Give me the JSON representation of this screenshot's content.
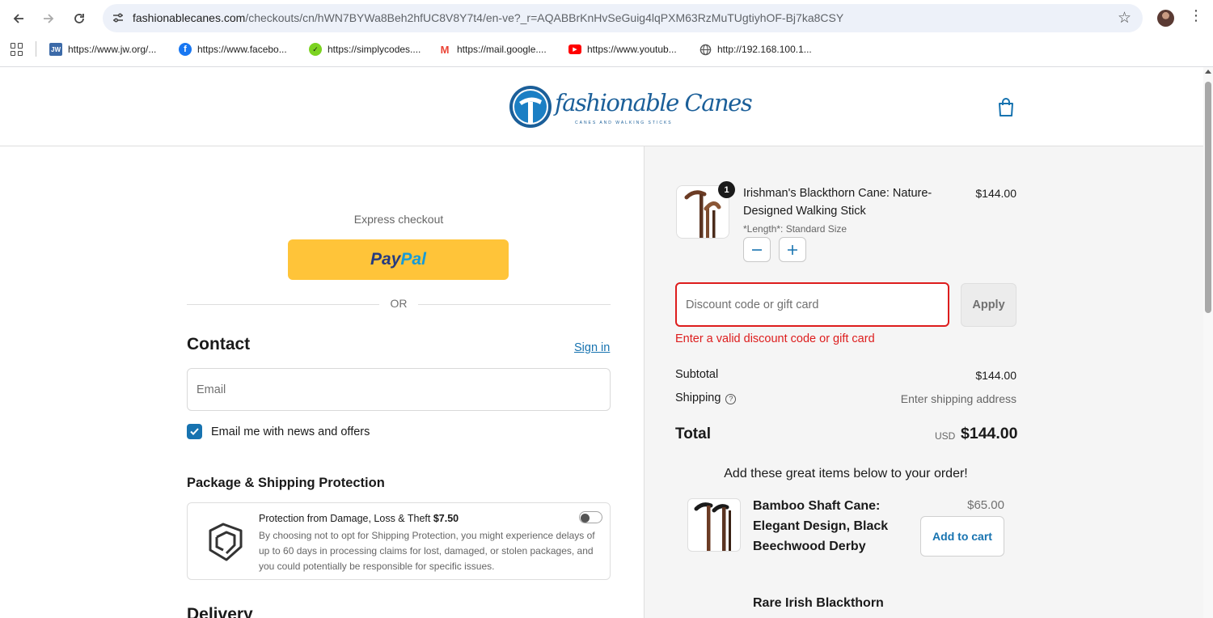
{
  "browser": {
    "url_host": "fashionablecanes.com",
    "url_path": "/checkouts/cn/hWN7BYWa8Beh2hfUC8V8Y7t4/en-ve?_r=AQABBrKnHvSeGuig4lqPXM63RzMuTUgtiyhOF-Bj7ka8CSY",
    "bookmarks": [
      {
        "label": "https://www.jw.org/...",
        "icon": "jw-icon"
      },
      {
        "label": "https://www.facebo...",
        "icon": "facebook-icon"
      },
      {
        "label": "https://simplycodes....",
        "icon": "simplycodes-icon"
      },
      {
        "label": "https://mail.google....",
        "icon": "gmail-icon"
      },
      {
        "label": "https://www.youtub...",
        "icon": "youtube-icon"
      },
      {
        "label": "http://192.168.100.1...",
        "icon": "globe-icon"
      }
    ]
  },
  "store": {
    "logo_text": "fashionable Canes",
    "logo_tagline": "CANES AND WALKING STICKS",
    "accent_color": "#1773b0"
  },
  "checkout": {
    "express_label": "Express checkout",
    "paypal_pay": "Pay",
    "paypal_pal": "Pal",
    "or_label": "OR",
    "contact_heading": "Contact",
    "signin_label": "Sign in",
    "email_placeholder": "Email",
    "newsletter_label": "Email me with news and offers",
    "newsletter_checked": true,
    "protection_heading": "Package & Shipping Protection",
    "protection_title": "Protection from Damage, Loss & Theft ",
    "protection_price": "$7.50",
    "protection_desc": "By choosing not to opt for Shipping Protection, you might experience delays of up to 60 days in processing claims for lost, damaged, or stolen packages, and you could potentially be responsible for specific issues.",
    "protection_enabled": false,
    "delivery_heading": "Delivery"
  },
  "summary": {
    "item": {
      "quantity": "1",
      "name": "Irishman's Blackthorn Cane: Nature-Designed Walking Stick",
      "variant": "*Length*: Standard Size",
      "price": "$144.00"
    },
    "discount_placeholder": "Discount code or gift card",
    "apply_label": "Apply",
    "discount_error": "Enter a valid discount code or gift card",
    "subtotal_label": "Subtotal",
    "subtotal_value": "$144.00",
    "shipping_label": "Shipping",
    "shipping_value": "Enter shipping address",
    "total_label": "Total",
    "total_currency": "USD",
    "total_value": "$144.00",
    "upsell_title": "Add these great items below to your order!",
    "upsells": [
      {
        "name": "Bamboo Shaft Cane: Elegant Design, Black Beechwood Derby",
        "price": "$65.00",
        "button": "Add to cart"
      },
      {
        "name": "Rare Irish Blackthorn"
      }
    ]
  }
}
